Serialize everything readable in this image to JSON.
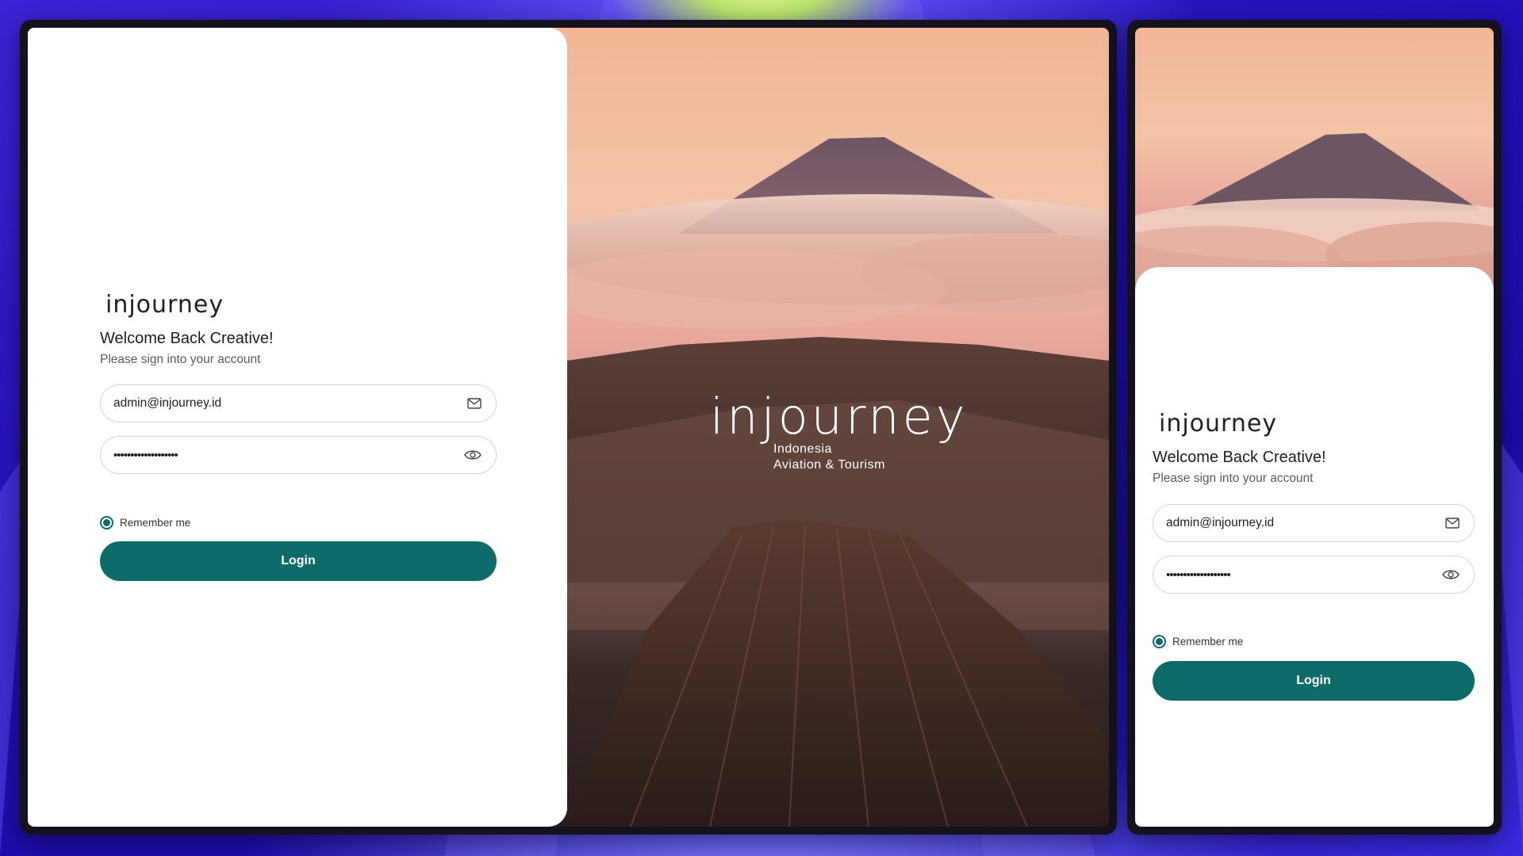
{
  "brand": {
    "logo_text": "injourney",
    "hero_logo_text": "injourney",
    "hero_tagline_line1": "Indonesia",
    "hero_tagline_line2": "Aviation & Tourism"
  },
  "desktop": {
    "welcome": "Welcome Back Creative!",
    "subtitle": "Please sign into your account",
    "email_value": "admin@injourney.id",
    "password_mask": "•••••••••••••••••••",
    "remember_label": "Remember me",
    "remember_checked": true,
    "login_label": "Login"
  },
  "mobile": {
    "welcome": "Welcome Back Creative!",
    "subtitle": "Please sign into your account",
    "email_value": "admin@injourney.id",
    "password_mask": "•••••••••••••••••••",
    "remember_label": "Remember me",
    "remember_checked": true,
    "login_label": "Login"
  },
  "icons": {
    "email_field_icon": "envelope-icon",
    "password_field_icon": "eye-icon",
    "logo_mark": "ring-of-dots-icon"
  },
  "colors": {
    "primary": "#0d6b6a",
    "panel_bg": "#ffffff",
    "backdrop": "#2a17c9",
    "logo_dot_colors": [
      "#e8412c",
      "#f3a21b",
      "#36a852",
      "#1c8bd0",
      "#8a3fc6",
      "#e2358a"
    ]
  }
}
